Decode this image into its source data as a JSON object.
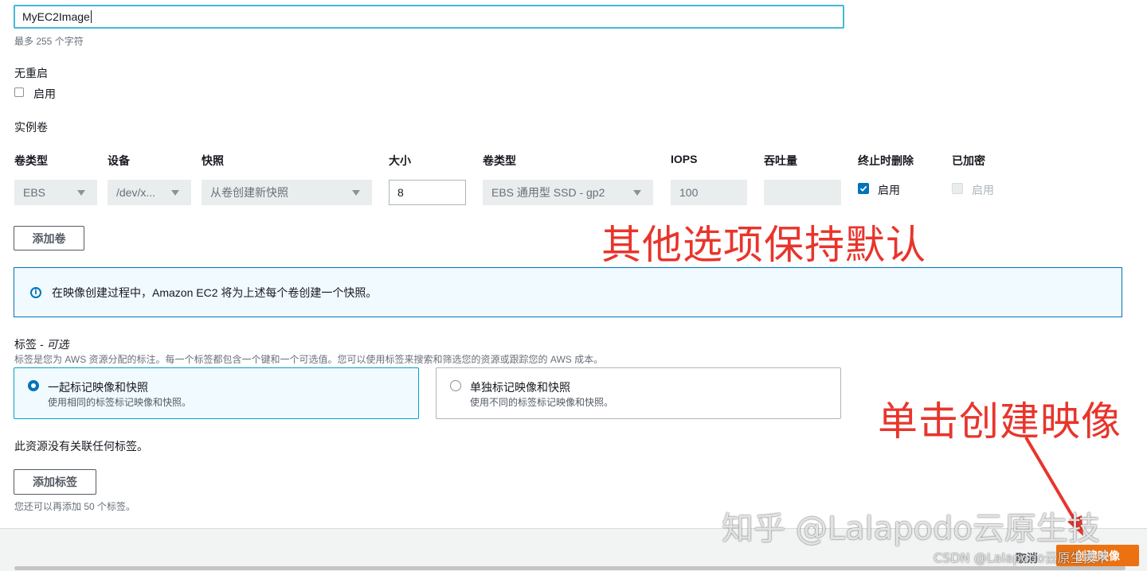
{
  "image_name": {
    "value": "MyEC2Image",
    "hint": "最多 255 个字符"
  },
  "no_reboot": {
    "label": "无重启",
    "checkbox_label": "启用"
  },
  "instance_volumes": {
    "title": "实例卷",
    "columns": [
      "卷类型",
      "设备",
      "快照",
      "大小",
      "卷类型",
      "IOPS",
      "吞吐量",
      "终止时删除",
      "已加密"
    ],
    "row": {
      "volume_type": "EBS",
      "device": "/dev/x...",
      "snapshot": "从卷创建新快照",
      "size": "8",
      "ebs_type": "EBS 通用型 SSD - gp2",
      "iops": "100",
      "throughput": "",
      "delete_on_termination_label": "启用",
      "encrypted_label": "启用"
    },
    "add_volume_button": "添加卷"
  },
  "info_alert": {
    "text": "在映像创建过程中，Amazon EC2 将为上述每个卷创建一个快照。"
  },
  "tags": {
    "title": "标签",
    "optional": " - 可选",
    "description": "标签是您为 AWS 资源分配的标注。每一个标签都包含一个键和一个可选值。您可以使用标签来搜索和筛选您的资源或跟踪您的 AWS 成本。",
    "option_together": {
      "title": "一起标记映像和快照",
      "desc": "使用相同的标签标记映像和快照。"
    },
    "option_separate": {
      "title": "单独标记映像和快照",
      "desc": "使用不同的标签标记映像和快照。"
    },
    "empty_text": "此资源没有关联任何标签。",
    "add_tag_button": "添加标签",
    "remaining_text": "您还可以再添加 50 个标签。"
  },
  "footer": {
    "cancel_label": "取消",
    "create_label": "创建映像"
  },
  "annotations": {
    "keep_defaults": "其他选项保持默认",
    "click_create": "单击创建映像"
  },
  "watermarks": {
    "zhihu": "知乎 @Lalapodo云原生技",
    "csdn": "CSDN @Lalapodo云原生技术"
  },
  "colors": {
    "primary_button": "#ec7211",
    "focus_border": "#44b9d6",
    "info_border": "#0073bb",
    "annotation": "#e8352c"
  }
}
